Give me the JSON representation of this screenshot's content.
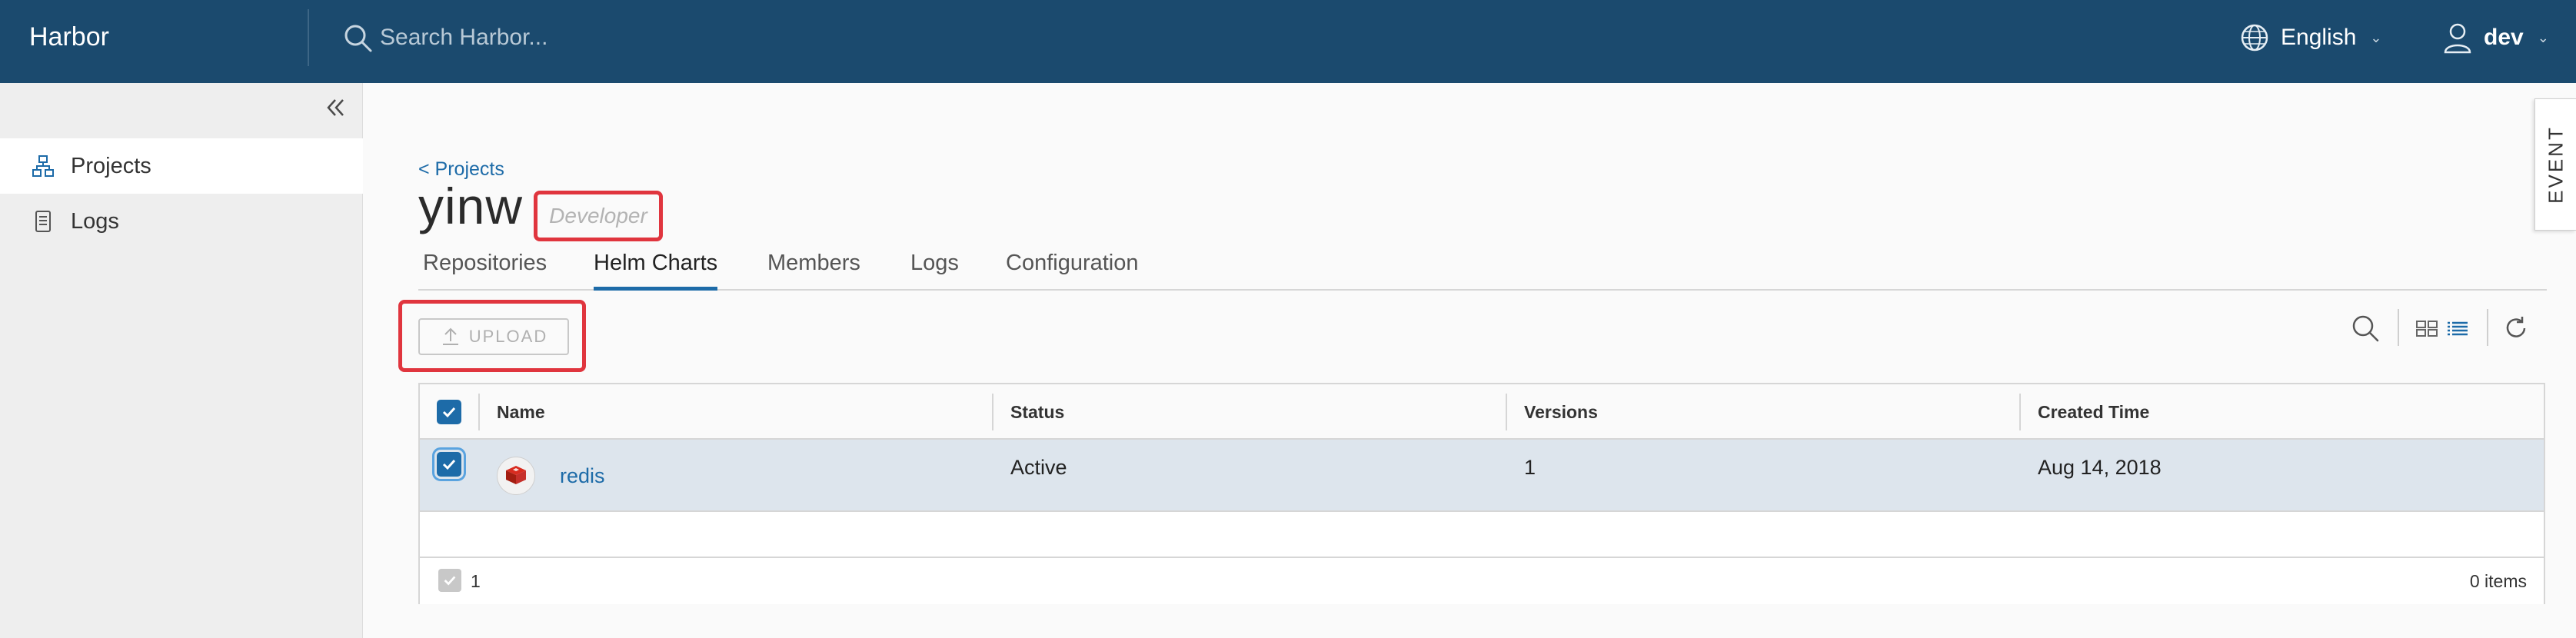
{
  "header": {
    "brand": "Harbor",
    "search_placeholder": "Search Harbor...",
    "language": "English",
    "user": "dev"
  },
  "sidebar": {
    "items": [
      {
        "label": "Projects",
        "icon": "projects-icon",
        "active": true
      },
      {
        "label": "Logs",
        "icon": "logs-icon",
        "active": false
      }
    ]
  },
  "event_tab": {
    "label": "EVENT"
  },
  "main": {
    "back_link": "< Projects",
    "project_name": "yinw",
    "role": "Developer",
    "tabs": [
      {
        "label": "Repositories",
        "active": false
      },
      {
        "label": "Helm Charts",
        "active": true
      },
      {
        "label": "Members",
        "active": false
      },
      {
        "label": "Logs",
        "active": false
      },
      {
        "label": "Configuration",
        "active": false
      }
    ],
    "upload_label": "UPLOAD"
  },
  "table": {
    "columns": [
      "Name",
      "Status",
      "Versions",
      "Created Time"
    ],
    "rows": [
      {
        "name": "redis",
        "status": "Active",
        "versions": "1",
        "created": "Aug 14, 2018",
        "selected": true
      }
    ],
    "footer": {
      "selected_count": "1",
      "total_items": "0 items"
    }
  },
  "colors": {
    "header_bg": "#1b4a6e",
    "accent": "#1d6ba8",
    "highlight_border": "#e0353e",
    "selected_row": "#dde5ed"
  }
}
